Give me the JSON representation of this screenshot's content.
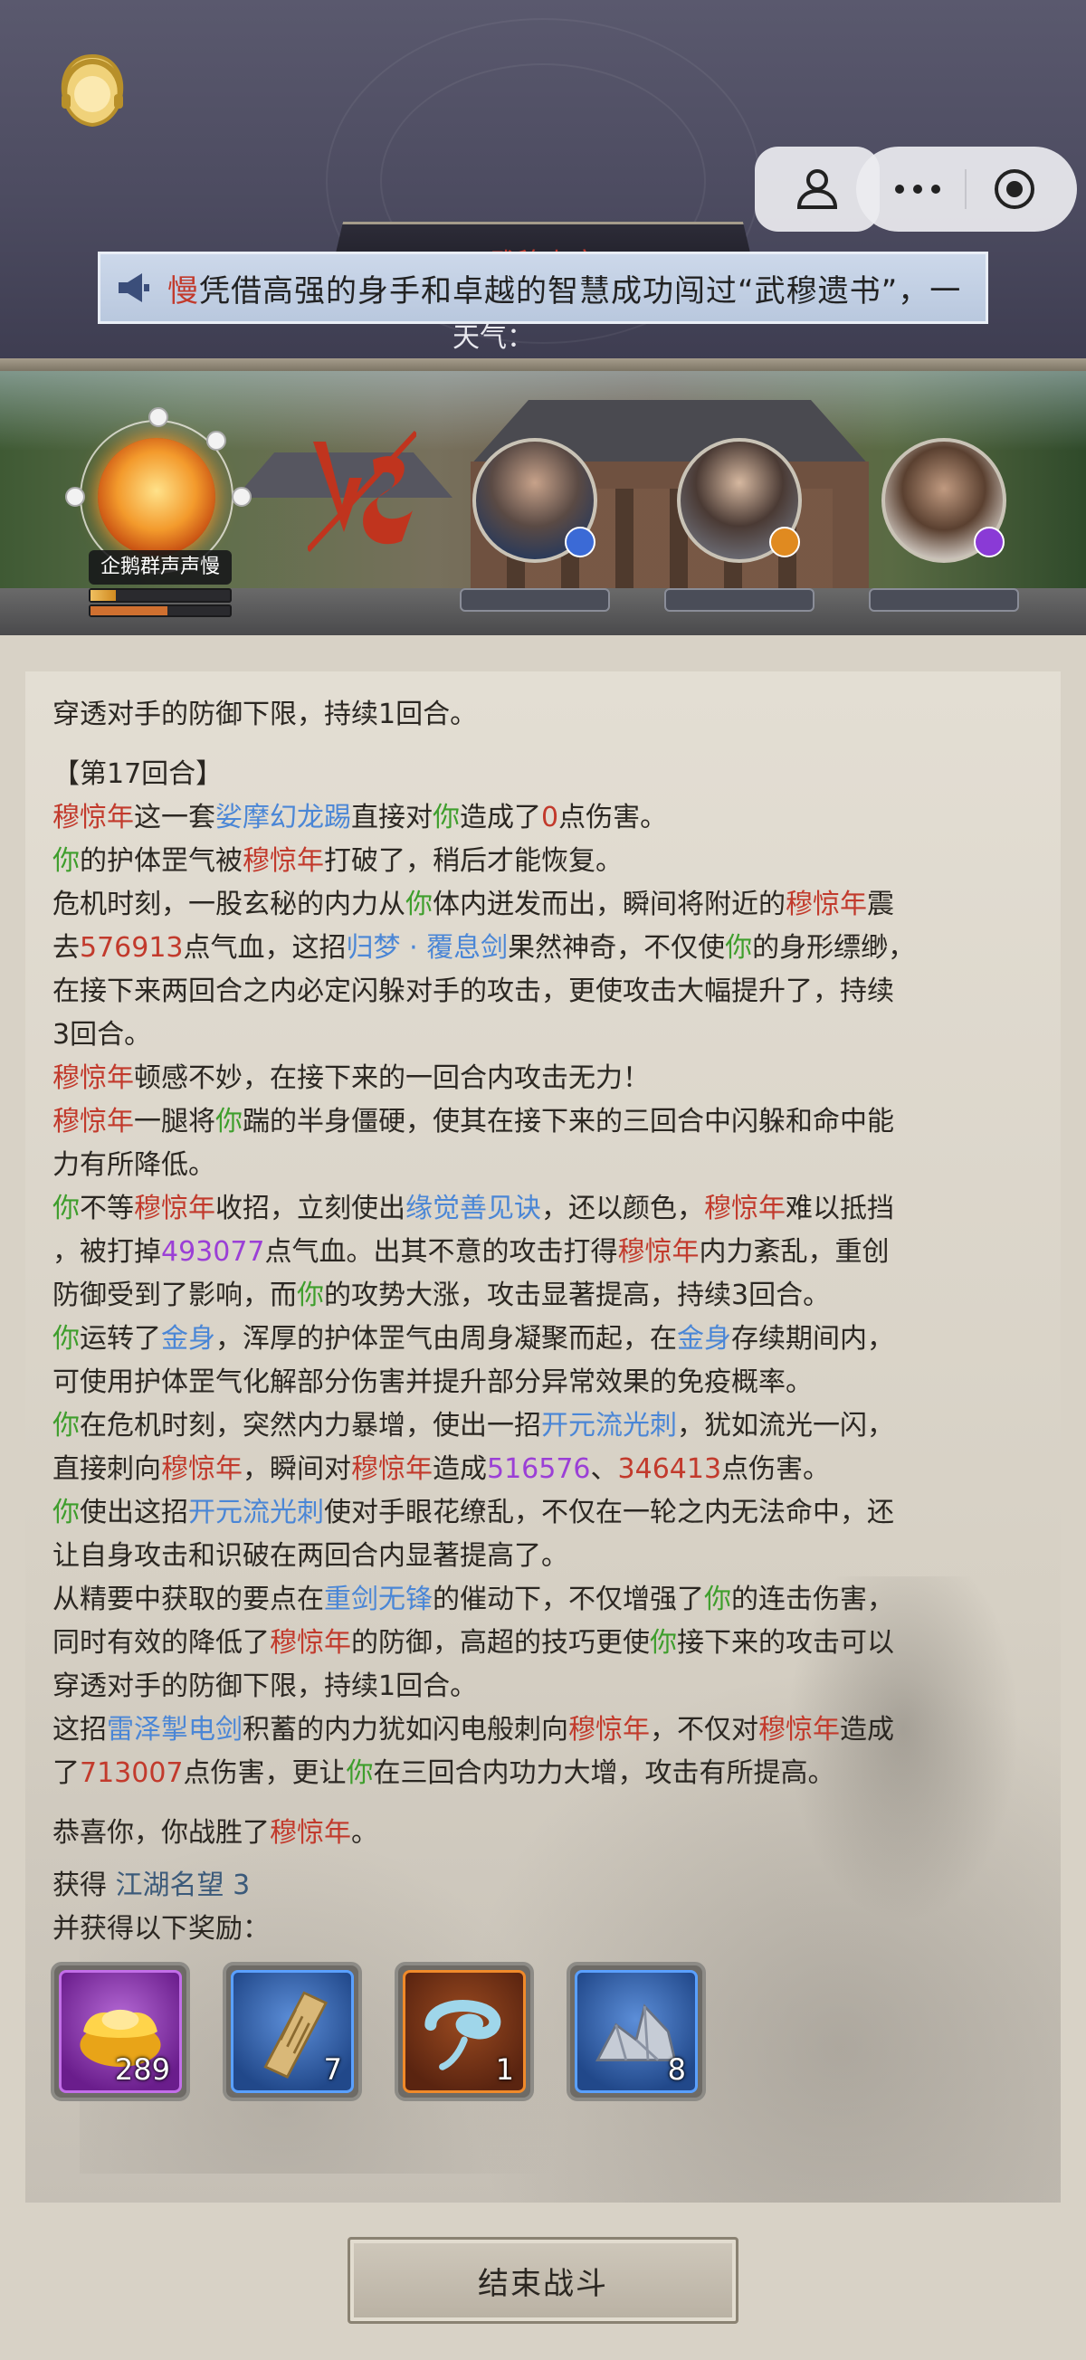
{
  "header": {
    "title_plate": "武穆山庄",
    "marquee_name": "慢",
    "marquee_text": "凭借高强的身手和卓越的智慧成功闯过“武穆遗书”，一",
    "weather_label": "天气："
  },
  "battle": {
    "player_name": "企鹅群声声慢",
    "player_hp_fraction": 0.18,
    "player_energy_fraction": 0.55
  },
  "log": {
    "l0": "穿透对手的防御下限，持续1回合。",
    "round": "【第17回合】",
    "l1a": "穆惊年",
    "l1b": "这一套",
    "l1c": "娑摩幻龙踢",
    "l1d": "直接对",
    "l1e": "你",
    "l1f": "造成了",
    "l1g": "0",
    "l1h": "点伤害。",
    "l2a": "你",
    "l2b": "的护体罡气被",
    "l2c": "穆惊年",
    "l2d": "打破了，稍后才能恢复。",
    "l3a": "危机时刻，一股玄秘的内力从",
    "l3b": "你",
    "l3c": "体内迸发而出，瞬间将附近的",
    "l3d": "穆惊年",
    "l3e": "震",
    "l4a": "去",
    "l4b": "576913",
    "l4c": "点气血，这招",
    "l4d": "归梦 · 覆息剑",
    "l4e": "果然神奇，不仅使",
    "l4f": "你",
    "l4g": "的身形缥缈，",
    "l5": "在接下来两回合之内必定闪躲对手的攻击，更使攻击大幅提升了，持续",
    "l6": "3回合。",
    "l7a": "穆惊年",
    "l7b": "顿感不妙，在接下来的一回合内攻击无力！",
    "l8a": "穆惊年",
    "l8b": "一腿将",
    "l8c": "你",
    "l8d": "踹的半身僵硬，使其在接下来的三回合中闪躲和命中能",
    "l9": "力有所降低。",
    "l10a": "你",
    "l10b": "不等",
    "l10c": "穆惊年",
    "l10d": "收招，立刻使出",
    "l10e": "缘觉善见诀",
    "l10f": "，还以颜色，",
    "l10g": "穆惊年",
    "l10h": "难以抵挡",
    "l11a": "，被打掉",
    "l11b": "493077",
    "l11c": "点气血。出其不意的攻击打得",
    "l11d": "穆惊年",
    "l11e": "内力紊乱，重创",
    "l12a": "防御受到了影响，而",
    "l12b": "你",
    "l12c": "的攻势大涨，攻击显著提高，持续3回合。",
    "l13a": "你",
    "l13b": "运转了",
    "l13c": "金身",
    "l13d": "，浑厚的护体罡气由周身凝聚而起，在",
    "l13e": "金身",
    "l13f": "存续期间内，",
    "l14": "可使用护体罡气化解部分伤害并提升部分异常效果的免疫概率。",
    "l15a": "你",
    "l15b": "在危机时刻，突然内力暴增，使出一招",
    "l15c": "开元流光刺",
    "l15d": "，犹如流光一闪，",
    "l16a": "直接刺向",
    "l16b": "穆惊年",
    "l16c": "，瞬间对",
    "l16d": "穆惊年",
    "l16e": "造成",
    "l16f": "516576",
    "l16g": "、",
    "l16h": "346413",
    "l16i": "点伤害。",
    "l17a": "你",
    "l17b": "使出这招",
    "l17c": "开元流光刺",
    "l17d": "使对手眼花缭乱，不仅在一轮之内无法命中，还",
    "l18": "让自身攻击和识破在两回合内显著提高了。",
    "l19a": "从精要中获取的要点在",
    "l19b": "重剑无锋",
    "l19c": "的催动下，不仅增强了",
    "l19d": "你",
    "l19e": "的连击伤害，",
    "l20a": "同时有效的降低了",
    "l20b": "穆惊年",
    "l20c": "的防御，高超的技巧更使",
    "l20d": "你",
    "l20e": "接下来的攻击可以",
    "l21": "穿透对手的防御下限，持续1回合。",
    "l22a": "这招",
    "l22b": "雷泽掣电剑",
    "l22c": "积蓄的内力犹如闪电般刺向",
    "l22d": "穆惊年",
    "l22e": "，不仅对",
    "l22f": "穆惊年",
    "l22g": "造成",
    "l23a": "了",
    "l23b": "713007",
    "l23c": "点伤害，更让",
    "l23d": "你",
    "l23e": "在三回合内功力大增，攻击有所提高。",
    "v1": "恭喜你，你战胜了",
    "v2": "穆惊年",
    "v3": "。",
    "gain_label": "获得 ",
    "gain_item": "江湖名望 3",
    "gain_more": "并获得以下奖励："
  },
  "rewards": [
    {
      "icon": "gold-ingot-icon",
      "count": "289",
      "rarity": "purple"
    },
    {
      "icon": "bamboo-scroll-icon",
      "count": "7",
      "rarity": "blue"
    },
    {
      "icon": "swirl-essence-icon",
      "count": "1",
      "rarity": "orange"
    },
    {
      "icon": "ore-crystal-icon",
      "count": "8",
      "rarity": "blue"
    }
  ],
  "end_button": "结束战斗",
  "colors": {
    "enemy_red": "#c23a2c",
    "you_green": "#3e9e2c",
    "skill_blue": "#4a86d6",
    "number_purple": "#9b3fd6"
  }
}
